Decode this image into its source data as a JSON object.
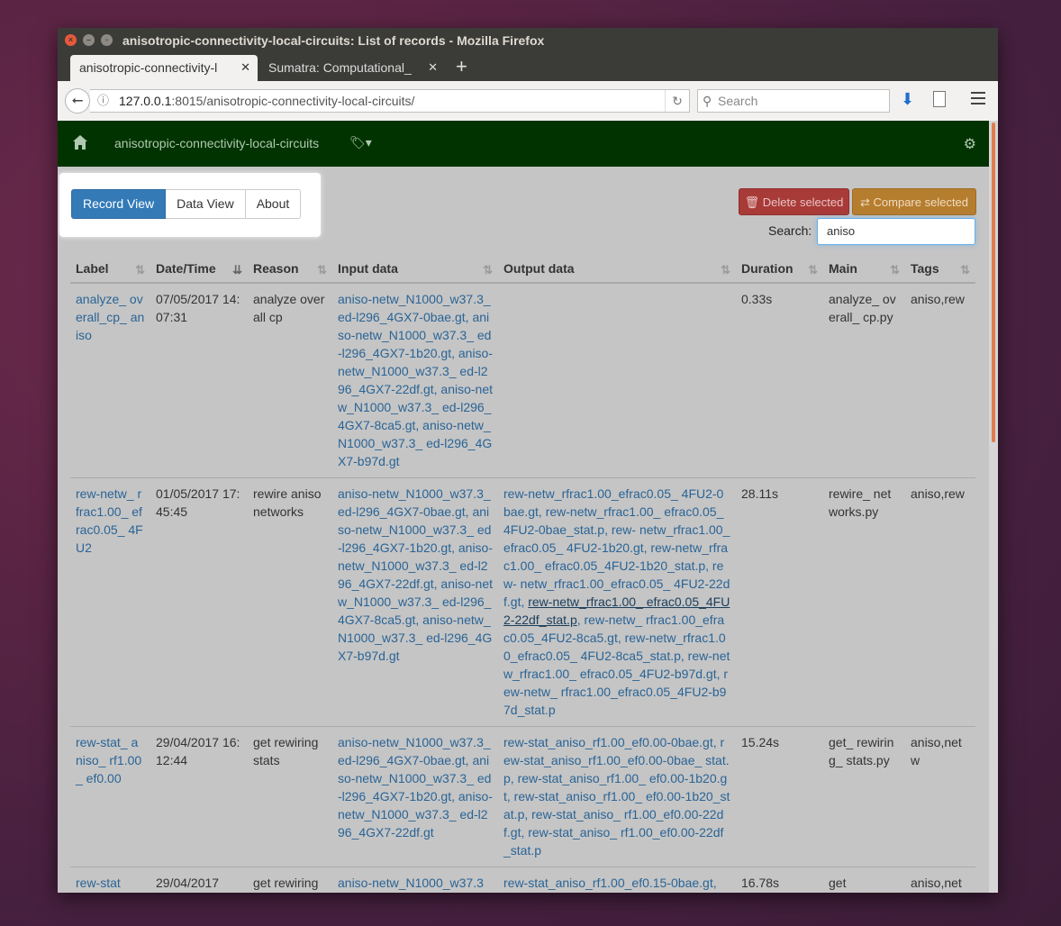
{
  "window": {
    "title": "anisotropic-connectivity-local-circuits: List of records - Mozilla Firefox"
  },
  "tabs": [
    {
      "label": "anisotropic-connectivity-l"
    },
    {
      "label": "Sumatra: Computational_"
    }
  ],
  "browser": {
    "url_host": "127.0.0.1",
    "url_rest": ":8015/anisotropic-connectivity-local-circuits/",
    "search_placeholder": "Search"
  },
  "app": {
    "project": "anisotropic-connectivity-local-circuits",
    "views": [
      "Record View",
      "Data View",
      "About"
    ],
    "delete_label": "Delete selected",
    "compare_label": "Compare selected",
    "search_label": "Search:",
    "search_value": "aniso",
    "accent": "#337ab7",
    "nav_color": "#003300"
  },
  "table": {
    "headers": [
      "Label",
      "Date/Time",
      "Reason",
      "Input data",
      "Output data",
      "Duration",
      "Main",
      "Tags"
    ],
    "rows": [
      {
        "label": "analyze_ overall_cp_ aniso",
        "datetime": "07/05/2017 14:07:31",
        "reason": "analyze overall cp",
        "input": "aniso-netw_N1000_w37.3_ ed-l296_4GX7-0bae.gt, aniso-netw_N1000_w37.3_ ed-l296_4GX7-1b20.gt, aniso-netw_N1000_w37.3_ ed-l296_4GX7-22df.gt, aniso-netw_N1000_w37.3_ ed-l296_4GX7-8ca5.gt, aniso-netw_N1000_w37.3_ ed-l296_4GX7-b97d.gt",
        "output": "",
        "duration": "0.33s",
        "main": "analyze_ overall_ cp.py",
        "tags": "aniso,rew"
      },
      {
        "label": "rew-netw_ rfrac1.00_ efrac0.05_ 4FU2",
        "datetime": "01/05/2017 17:45:45",
        "reason": "rewire aniso networks",
        "input": "aniso-netw_N1000_w37.3_ ed-l296_4GX7-0bae.gt, aniso-netw_N1000_w37.3_ ed-l296_4GX7-1b20.gt, aniso-netw_N1000_w37.3_ ed-l296_4GX7-22df.gt, aniso-netw_N1000_w37.3_ ed-l296_4GX7-8ca5.gt, aniso-netw_N1000_w37.3_ ed-l296_4GX7-b97d.gt",
        "output_a": "rew-netw_rfrac1.00_efrac0.05_ 4FU2-0bae.gt, rew-netw_rfrac1.00_ efrac0.05_4FU2-0bae_stat.p, rew- netw_rfrac1.00_efrac0.05_ 4FU2-1b20.gt, rew-netw_rfrac1.00_ efrac0.05_4FU2-1b20_stat.p, rew- netw_rfrac1.00_efrac0.05_ 4FU2-22df.gt, ",
        "output_u": "rew-netw_rfrac1.00_ efrac0.05_4FU2-22df_stat.p",
        "output_b": ", rew-netw_ rfrac1.00_efrac0.05_4FU2-8ca5.gt, rew-netw_rfrac1.00_efrac0.05_ 4FU2-8ca5_stat.p, rew-netw_rfrac1.00_ efrac0.05_4FU2-b97d.gt, rew-netw_ rfrac1.00_efrac0.05_4FU2-b97d_stat.p",
        "duration": "28.11s",
        "main": "rewire_ networks.py",
        "tags": "aniso,rew"
      },
      {
        "label": "rew-stat_ aniso_ rf1.00_ ef0.00",
        "datetime": "29/04/2017 16:12:44",
        "reason": "get rewiring stats",
        "input": "aniso-netw_N1000_w37.3_ ed-l296_4GX7-0bae.gt, aniso-netw_N1000_w37.3_ ed-l296_4GX7-1b20.gt, aniso-netw_N1000_w37.3_ ed-l296_4GX7-22df.gt",
        "output": "rew-stat_aniso_rf1.00_ef0.00-0bae.gt, rew-stat_aniso_rf1.00_ef0.00-0bae_ stat.p, rew-stat_aniso_rf1.00_ ef0.00-1b20.gt, rew-stat_aniso_rf1.00_ ef0.00-1b20_stat.p, rew-stat_aniso_ rf1.00_ef0.00-22df.gt, rew-stat_aniso_ rf1.00_ef0.00-22df_stat.p",
        "duration": "15.24s",
        "main": "get_ rewiring_ stats.py",
        "tags": "aniso,netw"
      },
      {
        "label": "rew-stat",
        "datetime": "29/04/2017",
        "reason": "get rewiring",
        "input": "aniso-netw_N1000_w37.3",
        "output": "rew-stat_aniso_rf1.00_ef0.15-0bae.gt,",
        "duration": "16.78s",
        "main": "get",
        "tags": "aniso,netw"
      }
    ]
  }
}
